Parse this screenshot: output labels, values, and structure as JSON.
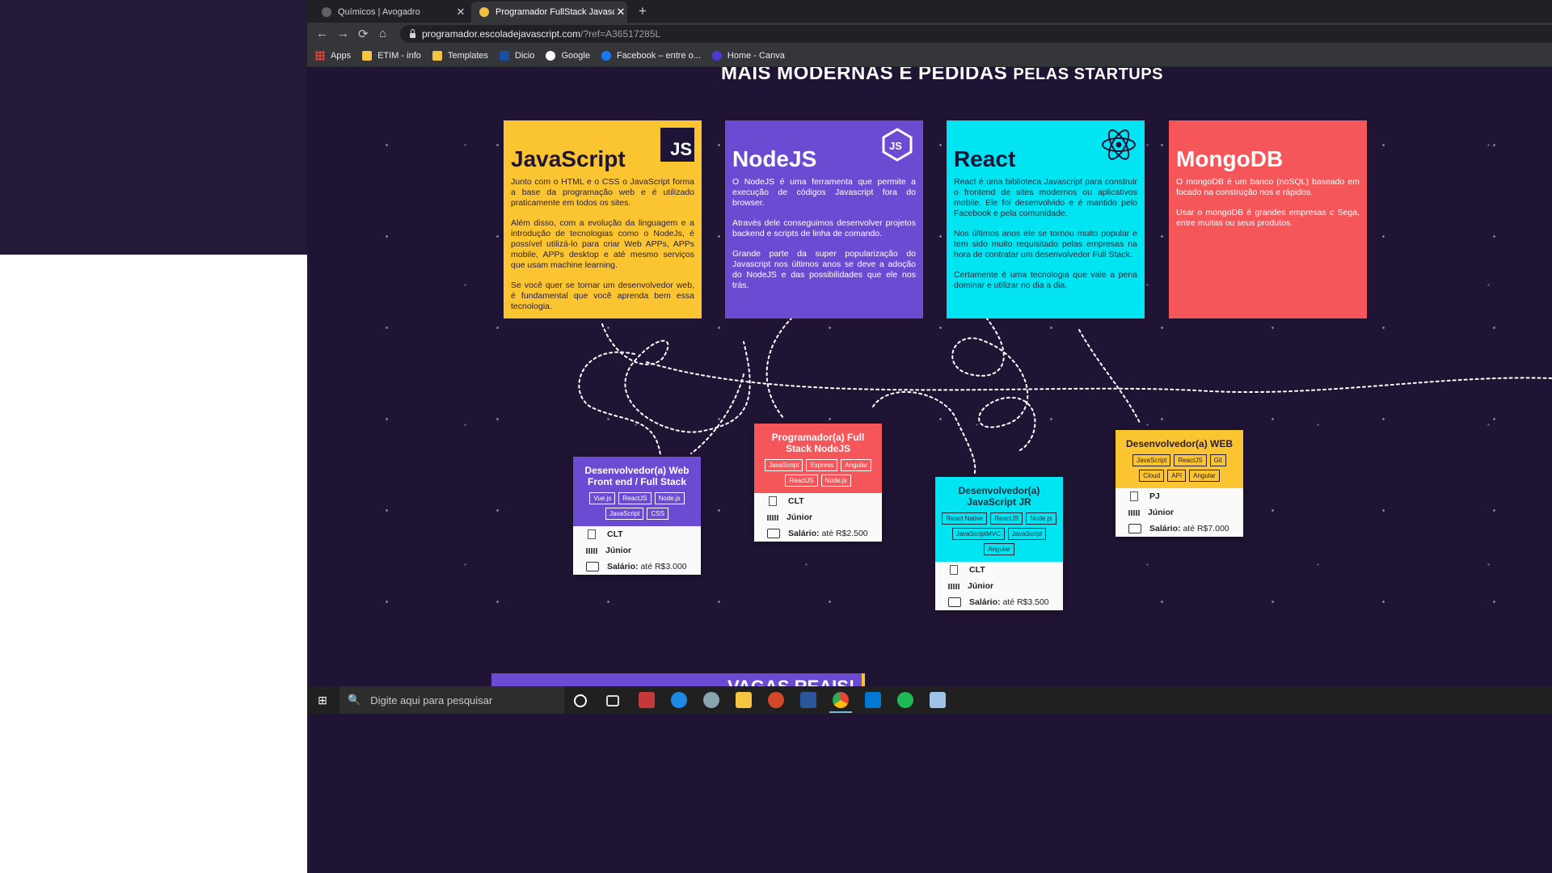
{
  "browser": {
    "tabs": [
      {
        "title": "Químicos | Avogadro",
        "close": "✕"
      },
      {
        "title": "Programador FullStack Javascript",
        "close": "✕"
      }
    ],
    "new_tab": "+",
    "nav": {
      "back": "←",
      "forward": "→",
      "reload": "⟳",
      "home": "⌂"
    },
    "url_host": "programador.escoladejavascript.com",
    "url_path": "/?ref=A36517285L",
    "bookmarks": [
      {
        "label": "Apps",
        "icon": "apps-grid-icon"
      },
      {
        "label": "ETIM - info",
        "icon": "folder-icon"
      },
      {
        "label": "Templates",
        "icon": "folder-icon"
      },
      {
        "label": "Dicio",
        "icon": "dicio-icon"
      },
      {
        "label": "Google",
        "icon": "google-icon"
      },
      {
        "label": "Facebook – entre o...",
        "icon": "facebook-icon"
      },
      {
        "label": "Home - Canva",
        "icon": "canva-icon"
      }
    ]
  },
  "headline": {
    "main": "MAIS MODERNAS E PEDIDAS",
    "small": "PELAS STARTUPS"
  },
  "tech_cards": [
    {
      "title": "JavaScript",
      "badge": "JS",
      "paragraphs": [
        "Junto com o HTML e o CSS o JavaScript forma a base da programação web e é utilizado praticamente em todos os sites.",
        "Além disso, com a evolução da linguagem e a introdução de tecnologias como o NodeJs, é possível utilizá-lo para criar Web APPs, APPs mobile, APPs desktop e até mesmo serviços que usam machine learning.",
        "Se você quer se tornar um desenvolvedor web, é fundamental que você aprenda bem essa tecnologia."
      ],
      "color": "#fbc531"
    },
    {
      "title": "NodeJS",
      "paragraphs": [
        "O NodeJS é uma ferramenta que permite a execução de códigos Javascript fora do browser.",
        "Através dele conseguimos desenvolver projetos backend e scripts de linha de comando.",
        "Grande parte da super popularização do Javascript nos últimos anos se deve a adoção do NodeJS e das possibilidades que ele nos trás."
      ],
      "color": "#6c4bd3"
    },
    {
      "title": "React",
      "paragraphs": [
        "React é uma biblioteca Javascript para construir o frontend de sites modernos ou aplicativos mobile. Ele foi desenvolvido e é mantido pelo Facebook e pela comunidade.",
        "Nos últimos anos ele se tornou muito popular e tem sido muito requisitado pelas empresas na hora de contratar um desenvolvedor Full Stack.",
        "Certamente é uma tecnologia que vale a pena dominar e utilizar no dia a dia."
      ],
      "color": "#00e5f1"
    },
    {
      "title": "MongoDB",
      "paragraphs": [
        "O mongoDB é um banco (noSQL) baseado em focado na construção nos e rápidos.",
        "Usar o mongoDB é grandes empresas c Sega, entre muitas ou seus produtos."
      ],
      "color": "#f4565a"
    }
  ],
  "jobs": [
    {
      "title": "Desenvolvedor(a) Web Front end / Full Stack",
      "tags": [
        "Vue.js",
        "ReactJS",
        "Node.js",
        "JavaScript",
        "CSS"
      ],
      "contract": "CLT",
      "level": "Júnior",
      "salary_label": "Salário:",
      "salary_value": "até R$3.000"
    },
    {
      "title": "Programador(a) Full Stack NodeJS",
      "tags": [
        "JavaScript",
        "Express",
        "Angular",
        "ReactJS",
        "Node.js"
      ],
      "contract": "CLT",
      "level": "Júnior",
      "salary_label": "Salário:",
      "salary_value": "até R$2.500"
    },
    {
      "title": "Desenvolvedor(a) JavaScript JR",
      "tags": [
        "React Native",
        "ReactJS",
        "Node.js",
        "JavaScriptMVC",
        "JavaScript",
        "Angular"
      ],
      "contract": "CLT",
      "level": "Júnior",
      "salary_label": "Salário:",
      "salary_value": "até R$3.500"
    },
    {
      "title": "Desenvolvedor(a) WEB",
      "tags": [
        "JavaScript",
        "ReactJS",
        "Git",
        "Cloud",
        "API",
        "Angular"
      ],
      "contract": "PJ",
      "level": "Júnior",
      "salary_label": "Salário:",
      "salary_value": "até R$7.000"
    }
  ],
  "vagas": "VAGAS REAIS!",
  "taskbar": {
    "start": "⊞",
    "search_placeholder": "Digite aqui para pesquisar",
    "search_icon": "🔍",
    "apps": [
      "cortana-icon",
      "task-view-icon",
      "app-icon",
      "edge-icon",
      "app-icon",
      "file-explorer-icon",
      "powerpoint-icon",
      "word-icon",
      "chrome-icon",
      "vscode-icon",
      "spotify-icon",
      "notes-icon"
    ]
  }
}
